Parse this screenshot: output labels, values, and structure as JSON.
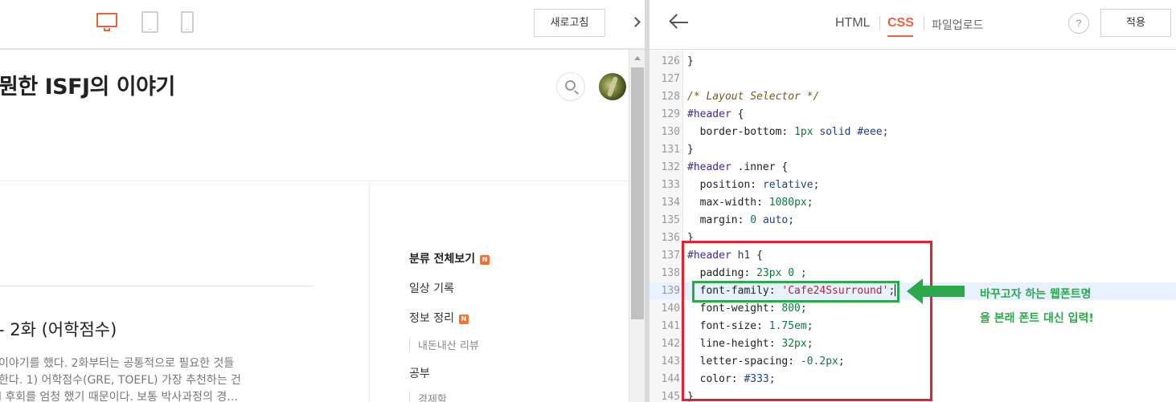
{
  "preview": {
    "refresh_label": "새로고침",
    "blog_title": "뭔한 ISFJ의 이야기",
    "post_title": "- 2화 (어학점수)",
    "post_excerpt_lines": [
      "이야기를 했다. 2화부터는 공통적으로 필요한 것들",
      "한다. 1) 어학점수(GRE, TOEFL) 가장 추천하는 건",
      "l 후회를 엄청 했기 때문이다. 보통 박사과정의 경…"
    ],
    "categories": {
      "all": "분류 전체보기",
      "daily": "일상 기록",
      "info": "정보 정리",
      "review": "내돈내산 리뷰",
      "study": "공부",
      "econ": "경제학"
    },
    "new_badge": "N"
  },
  "editor": {
    "tabs": {
      "html": "HTML",
      "css": "CSS",
      "upload": "파일업로드"
    },
    "help_label": "?",
    "apply_label": "적용",
    "line_numbers": [
      "126",
      "127",
      "128",
      "129",
      "130",
      "131",
      "132",
      "133",
      "134",
      "135",
      "136",
      "137",
      "138",
      "139",
      "140",
      "141",
      "142",
      "143",
      "144",
      "145"
    ]
  },
  "annotation": {
    "note_line1": "바꾸고자 하는 웹폰트명",
    "note_line2": "을 본래 폰트 대신 입력!",
    "box_color": "#e0242f",
    "highlight_color": "#2aa84a"
  },
  "colors": {
    "accent": "#ef5f3a",
    "badge": "#f5712d"
  }
}
